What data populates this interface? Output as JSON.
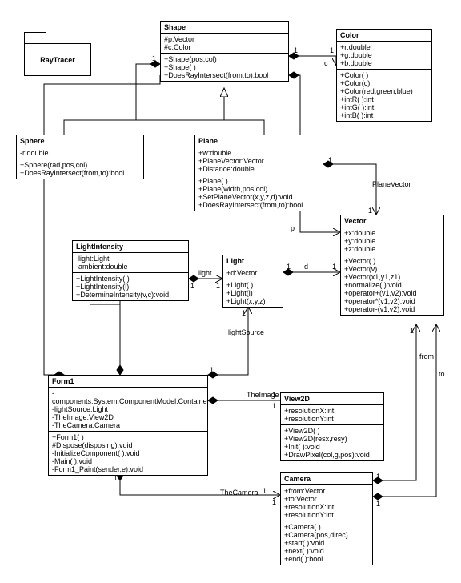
{
  "package": {
    "name": "RayTracer"
  },
  "classes": {
    "shape": {
      "name": "Shape",
      "attrs": [
        "#p:Vector",
        "#c:Color"
      ],
      "ops": [
        "+Shape(pos,col)",
        "+Shape( )",
        "+DoesRayIntersect(from,to):bool"
      ]
    },
    "color": {
      "name": "Color",
      "attrs": [
        "+r:double",
        "+g:double",
        "+b:double"
      ],
      "ops": [
        "+Color( )",
        "+Color(c)",
        "+Color(red,green,blue)",
        "+intR( ):int",
        "+intG( ):int",
        "+intB( ):int"
      ]
    },
    "sphere": {
      "name": "Sphere",
      "attrs": [
        "-r:double"
      ],
      "ops": [
        "+Sphere(rad,pos,col)",
        "+DoesRayIntersect(from,to):bool"
      ]
    },
    "plane": {
      "name": "Plane",
      "attrs": [
        "+w:double",
        "+PlaneVector:Vector",
        "+Distance:double"
      ],
      "ops": [
        "+Plane( )",
        "+Plane(width,pos,col)",
        "+SetPlaneVector(x,y,z,d):void",
        "+DoesRayIntersect(from,to):bool"
      ]
    },
    "vector": {
      "name": "Vector",
      "attrs": [
        "+x:double",
        "+y:double",
        "+z:double"
      ],
      "ops": [
        "+Vector( )",
        "+Vector(v)",
        "+Vector(x1,y1,z1)",
        "+normalize( ):void",
        "+operator+(v1,v2):void",
        "+operator*(v1,v2):void",
        "+operator-(v1,v2):void"
      ]
    },
    "lightintensity": {
      "name": "LightIntensity",
      "attrs": [
        "-light:Light",
        "-ambient:double"
      ],
      "ops": [
        "+LightIntensity( )",
        "+LightIntensity(l)",
        "+DetermineIntensity(v,c):void"
      ]
    },
    "light": {
      "name": "Light",
      "attrs": [
        "+d:Vector"
      ],
      "ops": [
        "+Light( )",
        "+Light(l)",
        "+Light(x,y,z)"
      ]
    },
    "form1": {
      "name": "Form1",
      "attrs": [
        "-components:System.ComponentModel.Container",
        "-lightSource:Light",
        "-TheImage:View2D",
        "-TheCamera:Camera"
      ],
      "ops": [
        "+Form1( )",
        "#Dispose(disposing):void",
        "-InitializeComponent( ):void",
        "-Main( ):void",
        "-Form1_Paint(sender,e):void"
      ]
    },
    "view2d": {
      "name": "View2D",
      "attrs": [
        "+resolutionX:int",
        "+resolutionY:int"
      ],
      "ops": [
        "+View2D( )",
        "+View2D(resx,resy)",
        "+Init( ):void",
        "+DrawPixel(col,g,pos):void"
      ]
    },
    "camera": {
      "name": "Camera",
      "attrs": [
        "+from:Vector",
        "+to:Vector",
        "+resolutionX:int",
        "+resolutionY:int"
      ],
      "ops": [
        "+Camera( )",
        "+Camera(pos,direc)",
        "+start( ):void",
        "+next( ):void",
        "+end( ):bool"
      ]
    }
  },
  "labels": {
    "c": "c",
    "p": "p",
    "planeVector": "PlaneVector",
    "light": "light",
    "d": "d",
    "lightSource": "lightSource",
    "theImage": "TheImage",
    "theCamera": "TheCamera",
    "from": "from",
    "to": "to",
    "one": "1"
  }
}
